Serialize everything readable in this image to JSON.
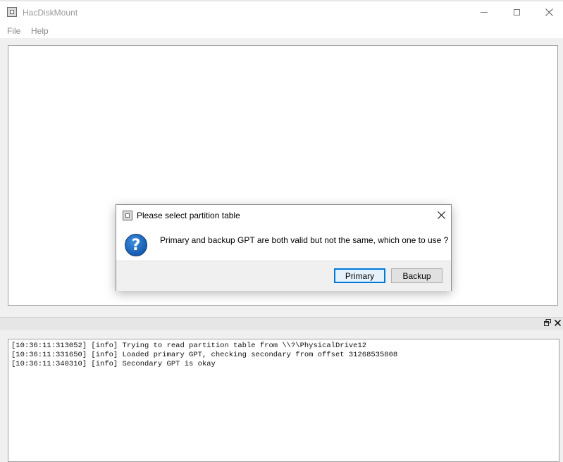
{
  "window": {
    "title": "HacDiskMount"
  },
  "menu": {
    "items": [
      {
        "label": "File"
      },
      {
        "label": "Help"
      }
    ]
  },
  "log": {
    "lines": [
      "[10:36:11:313052] [info] Trying to read partition table from \\\\?\\PhysicalDrive12",
      "[10:36:11:331650] [info] Loaded primary GPT, checking secondary from offset 31268535808",
      "[10:36:11:340310] [info] Secondary GPT is okay"
    ]
  },
  "dialog": {
    "title": "Please select partition table",
    "message": "Primary and backup GPT are both valid but not the same, which one to use ?",
    "buttons": {
      "primary": "Primary",
      "backup": "Backup"
    },
    "icon": "question-icon"
  },
  "colors": {
    "accent": "#0078d7",
    "question_icon": "#1a5fb4"
  }
}
